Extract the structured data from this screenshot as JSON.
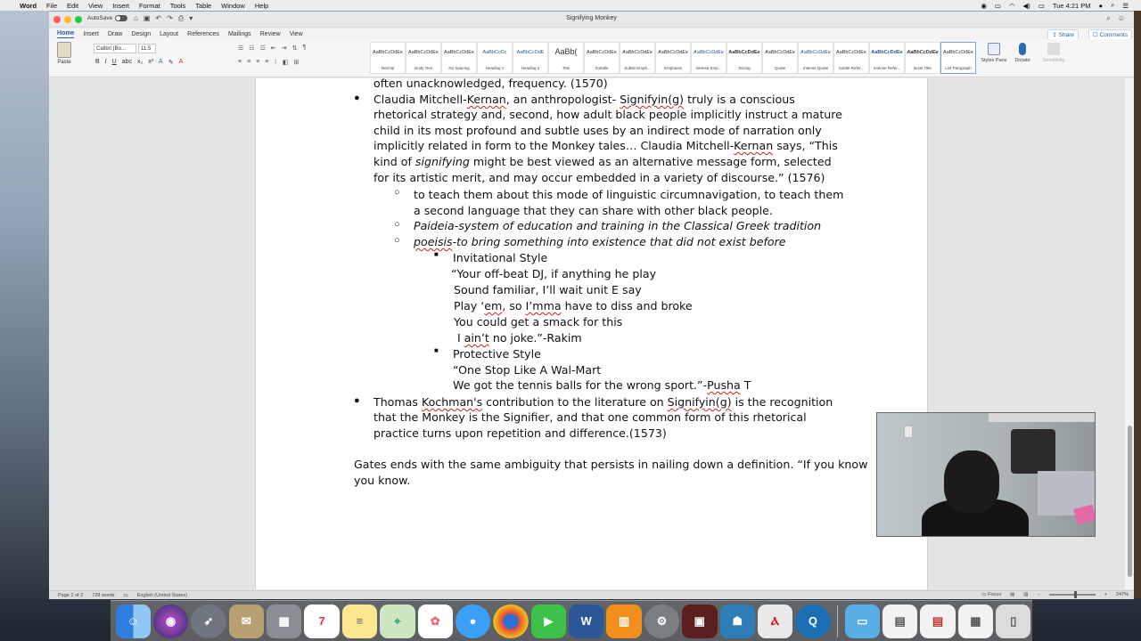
{
  "menubar": {
    "app": "Word",
    "items": [
      "File",
      "Edit",
      "View",
      "Insert",
      "Format",
      "Tools",
      "Table",
      "Window",
      "Help"
    ],
    "clock": "Tue 4:21 PM"
  },
  "window": {
    "autosave_label": "AutoSave",
    "autosave_state": "OFF",
    "title": "Signifying Monkey"
  },
  "ribbon": {
    "tabs": [
      "Home",
      "Insert",
      "Draw",
      "Design",
      "Layout",
      "References",
      "Mailings",
      "Review",
      "View"
    ],
    "active_tab": "Home",
    "share_label": "Share",
    "comments_label": "Comments",
    "paste_label": "Paste",
    "font_name": "Calibri (Bo...",
    "font_size": "11.5",
    "styles": [
      {
        "sample": "AaBbCcDdEe",
        "name": "Normal"
      },
      {
        "sample": "AaBbCcDdEe",
        "name": "Body Text"
      },
      {
        "sample": "AaBbCcDdEe",
        "name": "No Spacing"
      },
      {
        "sample": "AaBbCcDc",
        "name": "Heading 1"
      },
      {
        "sample": "AaBbCcDdE",
        "name": "Heading 2"
      },
      {
        "sample": "AaBb(",
        "name": "Title"
      },
      {
        "sample": "AaBbCcDdEe",
        "name": "Subtitle"
      },
      {
        "sample": "AaBbCcDdEe",
        "name": "Subtle Emph..."
      },
      {
        "sample": "AaBbCcDdEe",
        "name": "Emphasis"
      },
      {
        "sample": "AaBbCcDdEe",
        "name": "Intense Emp..."
      },
      {
        "sample": "AaBbCcDdEe",
        "name": "Strong"
      },
      {
        "sample": "AaBbCcDdEe",
        "name": "Quote"
      },
      {
        "sample": "AaBbCcDdEe",
        "name": "Intense Quote"
      },
      {
        "sample": "AaBbCcDdEe",
        "name": "Subtle Refer..."
      },
      {
        "sample": "AaBbCcDdEe",
        "name": "Intense Refer..."
      },
      {
        "sample": "AaBbCcDdEe",
        "name": "Book Title"
      },
      {
        "sample": "AaBbCcDdEe",
        "name": "List Paragraph"
      }
    ],
    "styles_pane_label": "Styles Pane",
    "dictate_label": "Dictate",
    "sensitivity_label": "Sensitivity"
  },
  "document": {
    "line0": "often unacknowledged, frequency. (1570)",
    "b1_l1_a": "Claudia Mitchell-",
    "b1_l1_b": "Kernan",
    "b1_l1_c": ", an anthropologist- ",
    "b1_l1_d": "Signifyin(g)",
    "b1_l1_e": " truly is a conscious",
    "b1_l2": "rhetorical strategy and, second, how adult black people implicitly instruct a mature",
    "b1_l3": "child in its most profound and subtle uses by an indirect mode of narration only",
    "b1_l4_a": "implicitly related in form to the Monkey tales… Claudia Mitchell-",
    "b1_l4_b": "Kernan",
    "b1_l4_c": " says, “This",
    "b1_l5_a": "kind of ",
    "b1_l5_b": "signifying",
    "b1_l5_c": " might be best viewed as an alternative message form, selected",
    "b1_l6": "for its artistic merit, and may occur embedded in a variety of discourse.” (1576)",
    "s1_l1": "to teach them about this mode of linguistic circumnavigation, to teach them",
    "s1_l2": "a second language that they can share with other black people.",
    "s2": "Paideia-system of education and training in the Classical Greek tradition",
    "s3_a": "poeisis",
    "s3_b": "-to bring something into existence that did not exist before",
    "t1": "Invitational Style",
    "q1": "“Your off-beat DJ, if anything he play",
    "q2": "Sound familiar, I’ll wait unit E say",
    "q3_a": "Play ‘",
    "q3_b": "em",
    "q3_c": ", so ",
    "q3_d": "I’mma",
    "q3_e": " have to diss and broke",
    "q4": "You could get a smack for this",
    "q5_a": "I ",
    "q5_b": "ain’t",
    "q5_c": " no joke.”-Rakim",
    "t2": "Protective Style",
    "p1": "“One Stop Like A Wal-Mart",
    "p2_a": "We got the tennis balls for the wrong sport.”-",
    "p2_b": "Pusha",
    "p2_c": " T",
    "b2_l1_a": "Thomas ",
    "b2_l1_b": "Kochman's",
    "b2_l1_c": " contribution to the literature on ",
    "b2_l1_d": "Signifyin(g)",
    "b2_l1_e": " is the recognition",
    "b2_l2": "that the Monkey is the Signifier, and that one common form of this rhetorical",
    "b2_l3": "practice turns upon repetition and difference.(1573)",
    "g1": "Gates ends with the same ambiguity that persists in nailing down a definition. “If you know",
    "g2": "you know."
  },
  "statusbar": {
    "page": "Page 2 of 2",
    "words": "728 words",
    "language": "English (United States)",
    "focus": "Focus",
    "zoom": "247%"
  },
  "colors": {
    "accent": "#1e5fb4",
    "squiggle": "#d02020"
  }
}
